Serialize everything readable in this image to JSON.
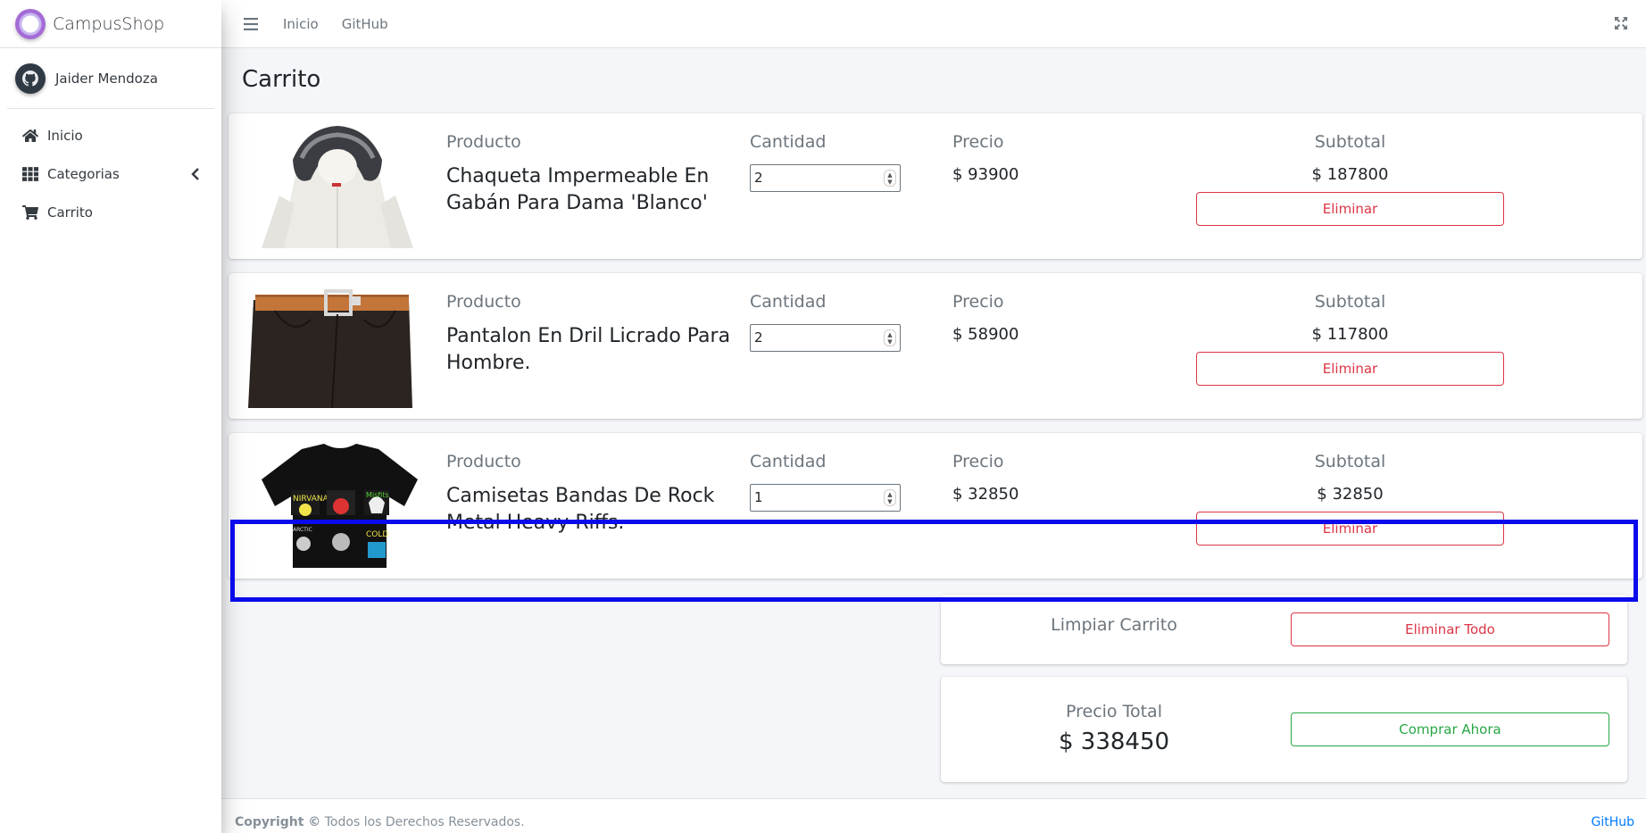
{
  "brand": {
    "name": "CampusShop"
  },
  "user": {
    "name": "Jaider Mendoza"
  },
  "sidebar": {
    "items": [
      {
        "label": "Inicio",
        "icon": "home-icon"
      },
      {
        "label": "Categorias",
        "icon": "grid-icon"
      },
      {
        "label": "Carrito",
        "icon": "cart-icon"
      }
    ]
  },
  "topbar": {
    "links": [
      "Inicio",
      "GitHub"
    ]
  },
  "page": {
    "title": "Carrito"
  },
  "labels": {
    "product": "Producto",
    "quantity": "Cantidad",
    "price": "Precio",
    "subtotal": "Subtotal",
    "remove": "Eliminar"
  },
  "cart": {
    "items": [
      {
        "name": "Chaqueta Impermeable En Gabán Para Dama 'Blanco'",
        "quantity": "2",
        "price": "$ 93900",
        "subtotal": "$ 187800",
        "image": "white-hooded-jacket"
      },
      {
        "name": "Pantalon En Dril Licrado Para Hombre.",
        "quantity": "2",
        "price": "$ 58900",
        "subtotal": "$ 117800",
        "image": "brown-pants-with-belt"
      },
      {
        "name": "Camisetas Bandas De Rock Metal Heavy Riffs.",
        "quantity": "1",
        "price": "$ 32850",
        "subtotal": "$ 32850",
        "image": "black-rock-band-tshirt"
      }
    ]
  },
  "summary": {
    "clear_label": "Limpiar Carrito",
    "clear_button": "Eliminar Todo",
    "total_label": "Precio Total",
    "total_value": "$ 338450",
    "buy_button": "Comprar Ahora"
  },
  "footer": {
    "copyright_bold": "Copyright ©",
    "copyright_text": " Todos los Derechos Reservados.",
    "link": "GitHub"
  },
  "colors": {
    "danger": "#dc3545",
    "success": "#28a745",
    "link": "#007bff",
    "highlight": "#0a0aeb"
  }
}
